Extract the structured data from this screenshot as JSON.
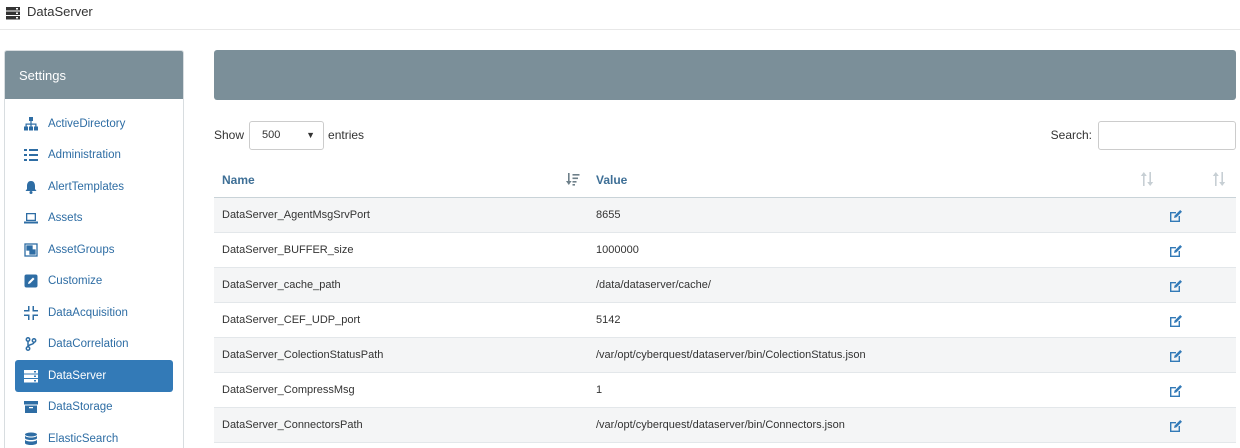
{
  "app": {
    "title": "DataServer",
    "icon": "server-icon"
  },
  "sidebar": {
    "header": "Settings",
    "items": [
      {
        "label": "ActiveDirectory",
        "icon": "sitemap-icon"
      },
      {
        "label": "Administration",
        "icon": "list-check-icon"
      },
      {
        "label": "AlertTemplates",
        "icon": "bell-icon"
      },
      {
        "label": "Assets",
        "icon": "laptop-icon"
      },
      {
        "label": "AssetGroups",
        "icon": "object-group-icon"
      },
      {
        "label": "Customize",
        "icon": "edit-square-icon"
      },
      {
        "label": "DataAcquisition",
        "icon": "compress-icon"
      },
      {
        "label": "DataCorrelation",
        "icon": "code-branch-icon"
      },
      {
        "label": "DataServer",
        "icon": "server-icon",
        "active": true
      },
      {
        "label": "DataStorage",
        "icon": "archive-icon"
      },
      {
        "label": "ElasticSearch",
        "icon": "database-icon"
      }
    ]
  },
  "controls": {
    "show_label": "Show",
    "entries_value": "500",
    "entries_label": "entries",
    "search_label": "Search:",
    "search_value": ""
  },
  "table": {
    "headers": {
      "name": "Name",
      "value": "Value"
    },
    "rows": [
      {
        "name": "DataServer_AgentMsgSrvPort",
        "value": "8655"
      },
      {
        "name": "DataServer_BUFFER_size",
        "value": "1000000"
      },
      {
        "name": "DataServer_cache_path",
        "value": "/data/dataserver/cache/"
      },
      {
        "name": "DataServer_CEF_UDP_port",
        "value": "5142"
      },
      {
        "name": "DataServer_ColectionStatusPath",
        "value": "/var/opt/cyberquest/dataserver/bin/ColectionStatus.json"
      },
      {
        "name": "DataServer_CompressMsg",
        "value": "1"
      },
      {
        "name": "DataServer_ConnectorsPath",
        "value": "/var/opt/cyberquest/dataserver/bin/Connectors.json"
      }
    ]
  },
  "colors": {
    "header_bg": "#7b8f99",
    "link": "#2e6da4",
    "active": "#337ab7",
    "edit": "#337ab7"
  }
}
